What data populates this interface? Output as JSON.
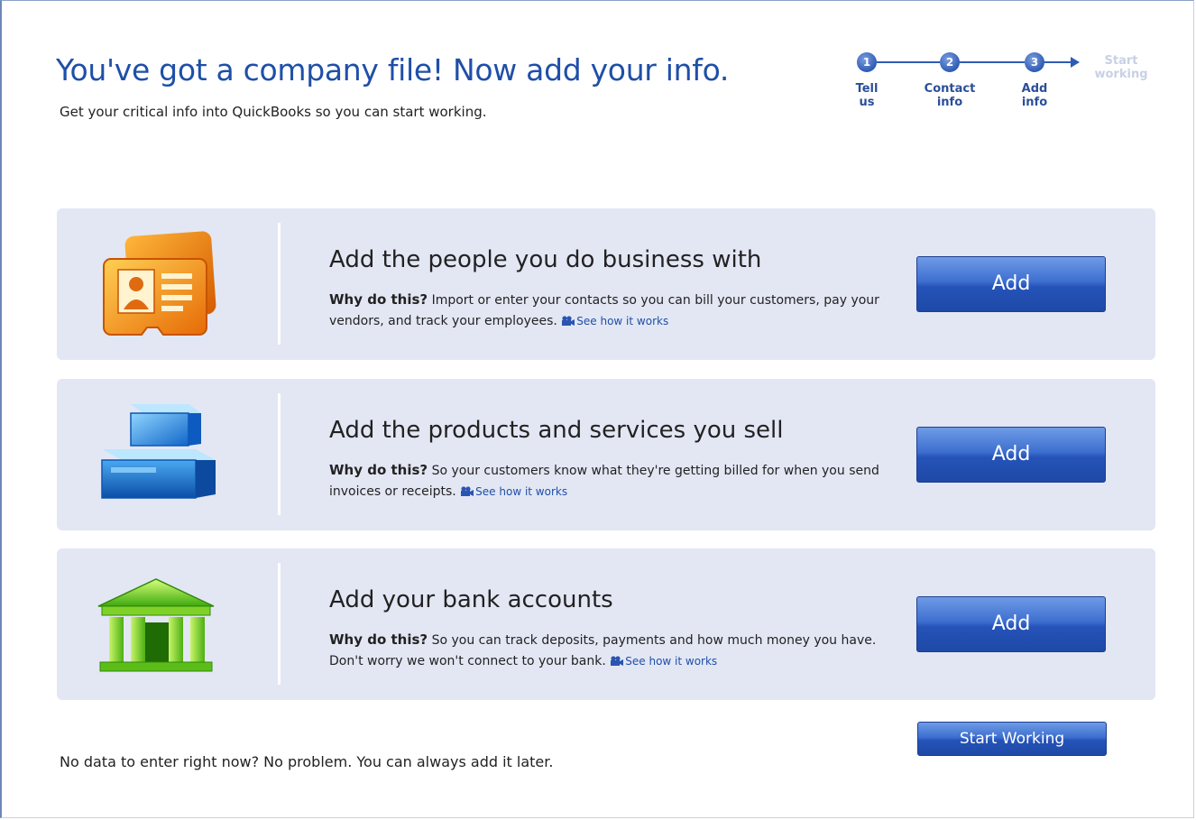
{
  "header": {
    "title": "You've got a company file! Now add your info.",
    "subtitle": "Get your critical info into QuickBooks so you can start working."
  },
  "steps": [
    {
      "number": "1",
      "label": "Tell\nus"
    },
    {
      "number": "2",
      "label": "Contact\ninfo"
    },
    {
      "number": "3",
      "label": "Add\ninfo"
    },
    {
      "label": "Start\nworking"
    }
  ],
  "cards": [
    {
      "icon": "contact-card-icon",
      "title": "Add the people you do business with",
      "why_label": "Why do this?",
      "description": "Import or enter your contacts so you can bill your customers, pay your vendors, and track your employees.",
      "link": "See how it works",
      "button": "Add"
    },
    {
      "icon": "product-boxes-icon",
      "title": "Add the products and services you sell",
      "why_label": "Why do this?",
      "description": "So your customers know what they're getting billed for when you send invoices or receipts.",
      "link": "See how it works",
      "button": "Add"
    },
    {
      "icon": "bank-building-icon",
      "title": "Add your bank accounts",
      "why_label": "Why do this?",
      "description": "So you can track deposits, payments and how much money you have. Don't worry we won't connect to your bank.",
      "link": "See how it works",
      "button": "Add"
    }
  ],
  "footer": {
    "note": "No data to enter right now? No problem. You can always add it later.",
    "start_button": "Start Working"
  },
  "colors": {
    "title_blue": "#1f4fa8",
    "card_bg": "#e3e7f4",
    "button_blue": "#2553b8"
  }
}
